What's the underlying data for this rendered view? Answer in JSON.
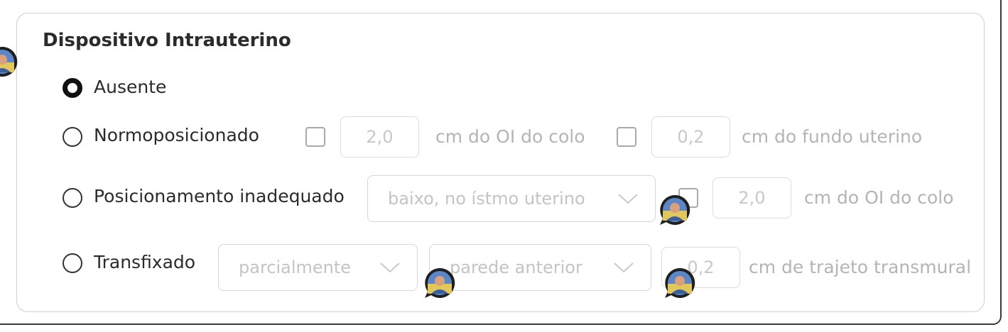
{
  "section": {
    "title": "Dispositivo Intrauterino"
  },
  "options": [
    {
      "label": "Ausente",
      "selected": true
    },
    {
      "label": "Normoposicionado",
      "selected": false
    },
    {
      "label": "Posicionamento inadequado",
      "selected": false
    },
    {
      "label": "Transfixado",
      "selected": false
    }
  ],
  "normoposicionado": {
    "colo_value": "2,0",
    "colo_unit": "cm do OI do colo",
    "fundo_value": "0,2",
    "fundo_unit": "cm do fundo uterino"
  },
  "posicionamento": {
    "select_value": "baixo, no ístmo uterino",
    "colo_value": "2,0",
    "colo_unit": "cm do OI do colo"
  },
  "transfixado": {
    "select_extent": "parcialmente",
    "select_wall": "parede anterior",
    "trajeto_value": "0,2",
    "trajeto_unit": "cm de trajeto transmural"
  },
  "icons": {
    "avatar": "user-avatar-icon",
    "chevron": "chevron-down-icon"
  },
  "colors": {
    "text": "#2b2b2b",
    "muted": "#b4b4b4",
    "border": "#cfcfcf"
  }
}
